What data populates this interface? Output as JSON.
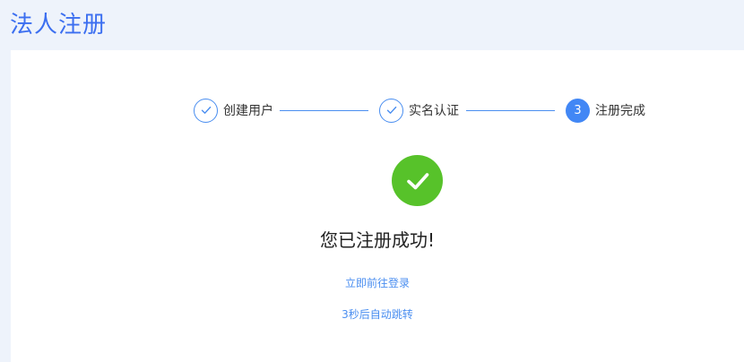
{
  "header": {
    "title": "法人注册"
  },
  "steps": [
    {
      "label": "创建用户",
      "status": "done"
    },
    {
      "label": "实名认证",
      "status": "done"
    },
    {
      "label": "注册完成",
      "status": "active",
      "number": "3"
    }
  ],
  "result": {
    "icon": "checkmark-icon",
    "message": "您已注册成功!",
    "login_link": "立即前往登录",
    "redirect_text": "3秒后自动跳转"
  },
  "colors": {
    "accent": "#4287f5",
    "success": "#57c22a",
    "title": "#3c6ff0"
  }
}
